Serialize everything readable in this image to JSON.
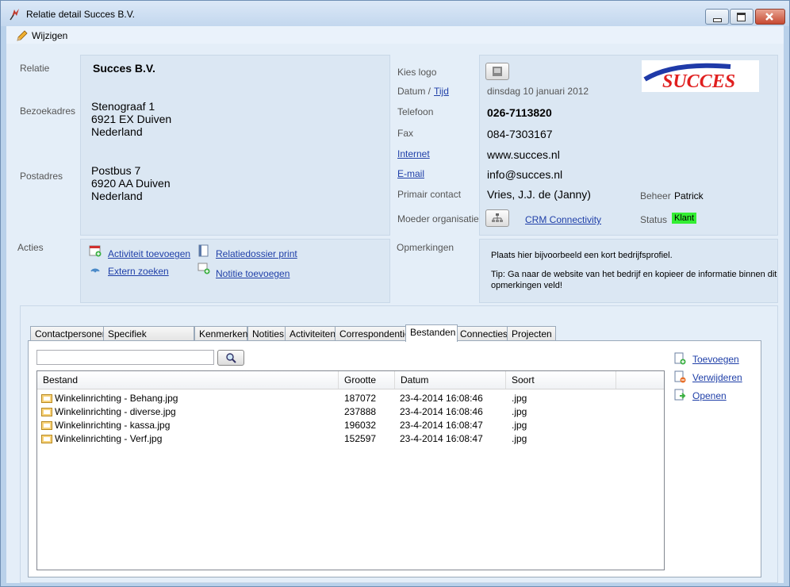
{
  "window": {
    "title": "Relatie detail Succes B.V.",
    "colors": {
      "accent": "#1f3fa8",
      "status_badge": "#33ee33"
    }
  },
  "menu": {
    "edit_label": "Wijzigen"
  },
  "relation": {
    "label_relatie": "Relatie",
    "name": "Succes B.V.",
    "label_bezoekadres": "Bezoekadres",
    "visit_address": [
      "Stenograaf 1",
      "6921 EX  Duiven",
      "Nederland"
    ],
    "label_postadres": "Postadres",
    "postal_address": [
      "Postbus 7",
      "6920 AA  Duiven",
      "Nederland"
    ]
  },
  "details": {
    "label_logo": "Kies logo",
    "logo_text": "SUCCES",
    "label_datum": "Datum /",
    "label_tijd": "Tijd",
    "date_value": "dinsdag 10 januari 2012",
    "label_telefoon": "Telefoon",
    "telefoon": "026-7113820",
    "label_fax": "Fax",
    "fax": "084-7303167",
    "label_internet": "Internet",
    "internet": "www.succes.nl",
    "label_email": "E-mail",
    "email": "info@succes.nl",
    "label_primair": "Primair contact",
    "primair": "Vries, J.J. de (Janny)",
    "label_beheer": "Beheer",
    "beheer": "Patrick",
    "label_moeder": "Moeder organisatie",
    "moeder": "CRM Connectivity",
    "label_status": "Status",
    "status": "Klant"
  },
  "actions": {
    "label": "Acties",
    "activity_add": "Activiteit toevoegen",
    "external_search": "Extern zoeken",
    "dossier_print": "Relatiedossier print",
    "note_add": "Notitie toevoegen"
  },
  "remarks": {
    "label": "Opmerkingen",
    "line1": "Plaats hier bijvoorbeeld een kort bedrijfsprofiel.",
    "line2": "Tip: Ga naar de website van het bedrijf en kopieer de informatie binnen dit",
    "line3": "opmerkingen veld!"
  },
  "tabs": [
    "Contactpersonen",
    "Specifiek relatieprofiel",
    "Kenmerken",
    "Notities",
    "Activiteiten",
    "Correspondentie",
    "Bestanden",
    "Connecties",
    "Projecten"
  ],
  "active_tab": "Bestanden",
  "files": {
    "search_value": "",
    "columns": [
      "Bestand",
      "Grootte",
      "Datum",
      "Soort"
    ],
    "rows": [
      {
        "name": "Winkelinrichting - Behang.jpg",
        "size": "187072",
        "date": "23-4-2014 16:08:46",
        "type": ".jpg"
      },
      {
        "name": "Winkelinrichting - diverse.jpg",
        "size": "237888",
        "date": "23-4-2014 16:08:46",
        "type": ".jpg"
      },
      {
        "name": "Winkelinrichting - kassa.jpg",
        "size": "196032",
        "date": "23-4-2014 16:08:47",
        "type": ".jpg"
      },
      {
        "name": "Winkelinrichting - Verf.jpg",
        "size": "152597",
        "date": "23-4-2014 16:08:47",
        "type": ".jpg"
      }
    ],
    "add_label": "Toevoegen",
    "remove_label": "Verwijderen",
    "open_label": "Openen"
  }
}
